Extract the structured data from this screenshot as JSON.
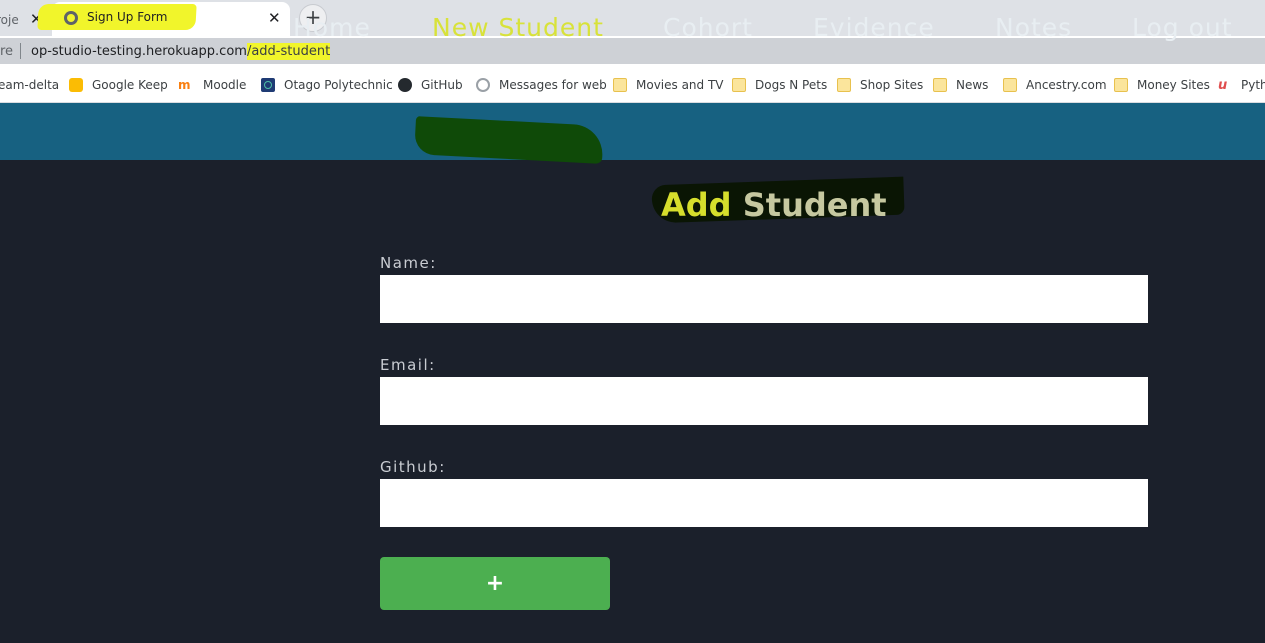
{
  "browser": {
    "prev_tab_label": "roje",
    "active_tab_title": "Sign Up Form",
    "address_prefix": "re",
    "url_host": "op-studio-testing.herokuapp.com",
    "url_path": "/add-student",
    "bookmarks": [
      {
        "label": "eam-delta",
        "icon": "none"
      },
      {
        "label": "Google Keep",
        "icon": "google-keep-icon"
      },
      {
        "label": "Moodle",
        "icon": "moodle-icon",
        "glyph": "m"
      },
      {
        "label": "Otago Polytechnic",
        "icon": "otago-icon"
      },
      {
        "label": "GitHub",
        "icon": "github-icon"
      },
      {
        "label": "Messages for web",
        "icon": "messages-icon"
      },
      {
        "label": "Movies and TV",
        "icon": "folder-icon"
      },
      {
        "label": "Dogs N Pets",
        "icon": "folder-icon"
      },
      {
        "label": "Shop Sites",
        "icon": "folder-icon"
      },
      {
        "label": "News",
        "icon": "folder-icon"
      },
      {
        "label": "Ancestry.com",
        "icon": "folder-icon"
      },
      {
        "label": "Money Sites",
        "icon": "folder-icon"
      },
      {
        "label": "Pyth",
        "icon": "python-icon",
        "glyph": "u"
      }
    ]
  },
  "nav": {
    "items": [
      "Home",
      "New Student",
      "Cohort",
      "Evidence",
      "Notes",
      "Log out"
    ],
    "active": "New Student"
  },
  "form": {
    "title_part1": "Add",
    "title_part2": " Student",
    "name_label": "Name:",
    "email_label": "Email:",
    "github_label": "Github:",
    "submit_label": "+"
  },
  "colors": {
    "nav_bg": "#176181",
    "page_bg": "#1b202b",
    "button_bg": "#4caf50",
    "highlight": "#f1f52b"
  }
}
